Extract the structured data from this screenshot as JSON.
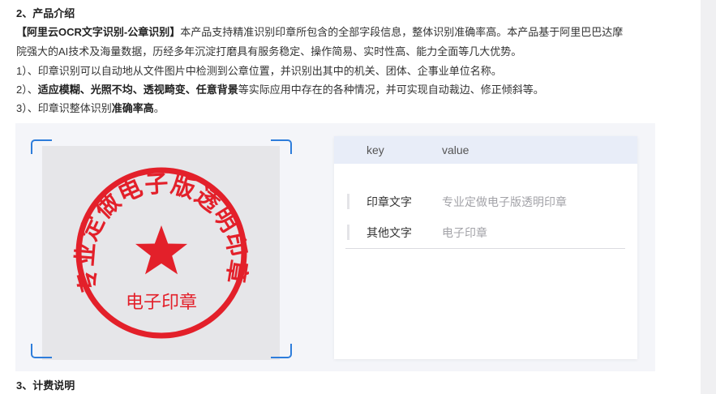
{
  "section2": {
    "heading": "2、产品介绍",
    "intro_bold": "【阿里云OCR文字识别-公章识别】",
    "intro_line1": "本产品支持精准识别印章所包含的全部字段信息，整体识别准确率高。本产品基于阿里巴巴达摩",
    "intro_line2": "院强大的AI技术及海量数据，历经多年沉淀打磨具有服务稳定、操作简易、实时性高、能力全面等几大优势。",
    "item1": "1）、印章识别可以自动地从文件图片中检测到公章位置，并识别出其中的机关、团体、企事业单位名称。",
    "item2_prefix": "2）、",
    "item2_bold": "适应模糊、光照不均、透视畸变、任意背景",
    "item2_rest": "等实际应用中存在的各种情况，并可实现自动裁边、修正倾斜等。",
    "item3_prefix": "3）、印章识整体识别",
    "item3_bold": "准确率高",
    "item3_suffix": "。"
  },
  "demo": {
    "stamp": {
      "ring_text": "专业定做电子版透明印章",
      "center_text": "电子印章",
      "icon": "star-icon",
      "color": "#e3202a"
    },
    "table": {
      "col_key": "key",
      "col_value": "value",
      "rows": [
        {
          "key": "印章文字",
          "value": "专业定做电子版透明印章"
        },
        {
          "key": "其他文字",
          "value": "电子印章"
        }
      ]
    },
    "frame_color": "#2e7ddb",
    "header_bg": "#e8edf8"
  },
  "section3": {
    "heading": "3、计费说明"
  }
}
